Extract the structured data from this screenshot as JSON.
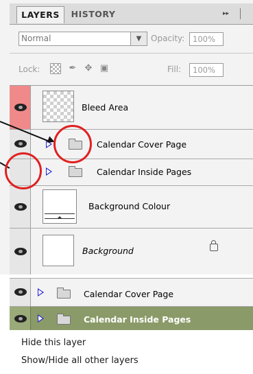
{
  "tabs": {
    "layers": "LAYERS",
    "history": "HISTORY",
    "menu_icon": "▸▸"
  },
  "blend_mode": {
    "value": "Normal",
    "arrow_icon": "chevron-down-icon"
  },
  "opacity": {
    "label": "Opacity:",
    "value": "100%"
  },
  "lock": {
    "label": "Lock:",
    "icons": [
      "lock-transparent-icon",
      "lock-brush-icon",
      "lock-move-icon",
      "lock-all-icon"
    ]
  },
  "fill": {
    "label": "Fill:",
    "value": "100%"
  },
  "layers": [
    {
      "name": "Bleed Area",
      "visible": true,
      "highlight_color": "#f08a8a"
    },
    {
      "name": "Calendar Cover Page",
      "visible": true,
      "type": "group"
    },
    {
      "name": "Calendar Inside Pages",
      "visible": false,
      "type": "group"
    },
    {
      "name": "Background Colour",
      "visible": true
    },
    {
      "name": "Background",
      "visible": true,
      "locked": true,
      "italic": true
    }
  ],
  "bottom_panel": {
    "rows": [
      {
        "name": "Calendar Cover Page",
        "visible": true,
        "type": "group"
      },
      {
        "name": "Calendar Inside Pages",
        "visible": true,
        "type": "group",
        "selected": true,
        "selected_color": "#8a9a68"
      }
    ],
    "context_menu": [
      "Hide this layer",
      "Show/Hide all other layers"
    ]
  },
  "annotation_color": "#e02020"
}
